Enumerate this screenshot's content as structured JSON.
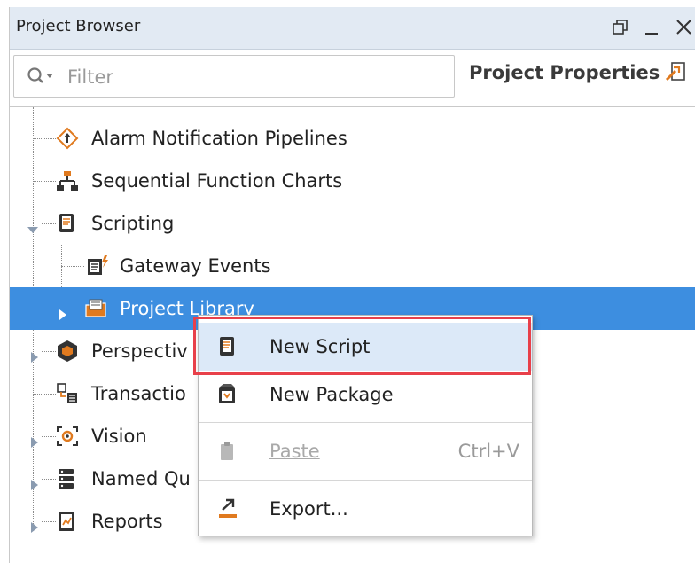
{
  "panel": {
    "title": "Project Browser",
    "controls": {
      "restore_icon": "restore-window-icon",
      "minimize_icon": "minimize-icon",
      "close_icon": "close-icon"
    }
  },
  "filter": {
    "placeholder": "Filter",
    "value": ""
  },
  "project_properties": {
    "label": "Project Properties"
  },
  "tree": {
    "items": [
      {
        "label": "Alarm Notification Pipelines",
        "icon": "alarm-pipeline-icon"
      },
      {
        "label": "Sequential Function Charts",
        "icon": "sfc-icon"
      },
      {
        "label": "Scripting",
        "icon": "scripting-icon",
        "expanded": true
      },
      {
        "label": "Gateway Events",
        "icon": "gateway-events-icon"
      },
      {
        "label": "Project Library",
        "icon": "project-library-icon",
        "selected": true
      },
      {
        "label": "Perspectiv",
        "icon": "perspective-icon"
      },
      {
        "label": "Transactio",
        "icon": "transaction-groups-icon"
      },
      {
        "label": "Vision",
        "icon": "vision-icon"
      },
      {
        "label": "Named Qu",
        "icon": "named-queries-icon"
      },
      {
        "label": "Reports",
        "icon": "reports-icon"
      }
    ]
  },
  "context_menu": {
    "items": [
      {
        "label": "New Script",
        "icon": "new-script-icon",
        "highlighted": true
      },
      {
        "label": "New Package",
        "icon": "new-package-icon"
      },
      {
        "label": "Paste",
        "icon": "paste-icon",
        "shortcut": "Ctrl+V",
        "disabled": true
      },
      {
        "label": "Export...",
        "icon": "export-icon"
      }
    ]
  },
  "colors": {
    "selection": "#3d8ee0",
    "highlight_outline": "#e8404a",
    "menu_hover": "#dce9f8",
    "titlebar": "#e2eaf3"
  }
}
